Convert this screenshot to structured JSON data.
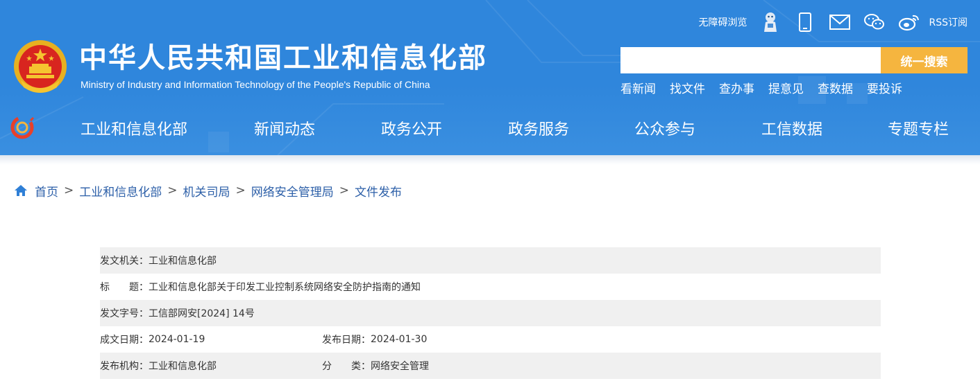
{
  "site": {
    "title_cn": "中华人民共和国工业和信息化部",
    "title_en": "Ministry of Industry and Information Technology of the People's Republic of China"
  },
  "toplinks": {
    "accessibility": "无障碍浏览",
    "rss": "RSS订阅"
  },
  "search": {
    "placeholder": "",
    "button": "统一搜索"
  },
  "quick_links": [
    "看新闻",
    "找文件",
    "查办事",
    "提意见",
    "查数据",
    "要投诉"
  ],
  "nav": [
    "工业和信息化部",
    "新闻动态",
    "政务公开",
    "政务服务",
    "公众参与",
    "工信数据",
    "专题专栏"
  ],
  "breadcrumb": [
    "首页",
    "工业和信息化部",
    "机关司局",
    "网络安全管理局",
    "文件发布"
  ],
  "meta": {
    "issuer_label": "发文机关：",
    "issuer": "工业和信息化部",
    "title_label": "标　　题：",
    "title": "工业和信息化部关于印发工业控制系统网络安全防护指南的通知",
    "docno_label": "发文字号：",
    "docno": "工信部网安[2024] 14号",
    "written_label": "成文日期：",
    "written": "2024-01-19",
    "published_label": "发布日期：",
    "published": "2024-01-30",
    "org_label": "发布机构：",
    "org": "工业和信息化部",
    "category_label": "分　　类：",
    "category": "网络安全管理"
  },
  "colors": {
    "header_blue": "#2f86dc",
    "search_button": "#f5b53f",
    "breadcrumb_link": "#2c5fa8",
    "row_gray": "#f0f0f0"
  }
}
